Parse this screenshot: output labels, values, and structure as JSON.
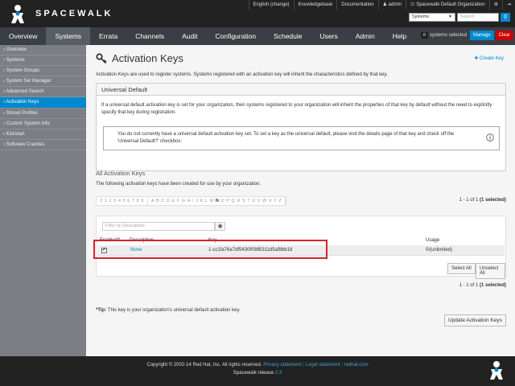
{
  "header": {
    "brand": "SPACEWALK",
    "utility": [
      "English (change)",
      "Knowledgebase",
      "Documentation",
      "admin",
      "Spacewalk Default Organization"
    ],
    "search_scope": "Systems",
    "search_placeholder": "Search"
  },
  "nav": {
    "items": [
      "Overview",
      "Systems",
      "Errata",
      "Channels",
      "Audit",
      "Configuration",
      "Schedule",
      "Users",
      "Admin",
      "Help"
    ],
    "active": "Systems",
    "selected_count": "0",
    "selected_text": "systems selected",
    "manage": "Manage",
    "clear": "Clear"
  },
  "sidebar": {
    "items": [
      "Overview",
      "Systems",
      "System Groups",
      "System Set Manager",
      "Advanced Search",
      "Activation Keys",
      "Stored Profiles",
      "Custom System Info",
      "Kickstart",
      "Software Crashes"
    ],
    "active": "Activation Keys"
  },
  "main": {
    "title": "Activation Keys",
    "create_key": "Create Key",
    "intro": "Activation Keys are used to register systems. Systems registered with an activation key will inherit the characteristics defined by that key.",
    "universal_default": {
      "heading": "Universal Default",
      "description": "If a universal default activation key is set for your organization, then systems registered to your organization will inherit the properties of that key by default without the need to explicitly specify that key during registration.",
      "alert": "You do not currently have a universal default activation key set. To set a key as the universal default, please visit the details page of that key and check off the 'Universal Default?' checkbox."
    },
    "all_keys": {
      "heading": "All Activation Keys",
      "description": "The following activation keys have been created for use by your organization.",
      "alpha_digits": [
        "0",
        "1",
        "2",
        "3",
        "4",
        "5",
        "6",
        "7",
        "8",
        "9"
      ],
      "alpha_letters": [
        "A",
        "B",
        "C",
        "D",
        "E",
        "F",
        "G",
        "H",
        "I",
        "J",
        "K",
        "L",
        "M",
        "N",
        "O",
        "P",
        "Q",
        "R",
        "S",
        "T",
        "U",
        "V",
        "W",
        "X",
        "Y",
        "Z"
      ],
      "alpha_active": "N",
      "pager_range": "1 - 1 of 1",
      "pager_selected": "(1 selected)",
      "filter_placeholder": "Filter by Description:",
      "columns": [
        "Enabled?",
        "Description",
        "Key",
        "Usage"
      ],
      "rows": [
        {
          "enabled": true,
          "description": "None",
          "key": "1-cc1fa76a7df5430f0985311d5af8bb18",
          "usage": "0/(unlimited)"
        }
      ],
      "select_all": "Select All",
      "unselect_all": "Unselect All"
    },
    "tip_label": "*Tip:",
    "tip_text": "This key is your organization's universal default activation key.",
    "update_button": "Update Activation Keys"
  },
  "footer": {
    "copyright": "Copyright © 2002-14 Red Hat, Inc. All rights reserved.",
    "privacy": "Privacy statement",
    "legal": "Legal statement",
    "redhat": "redhat.com",
    "release_label": "Spacewalk release",
    "release_version": "2.3"
  },
  "colors": {
    "accent": "#0088ce",
    "danger": "#cc0000",
    "highlight": "#d9212b"
  }
}
